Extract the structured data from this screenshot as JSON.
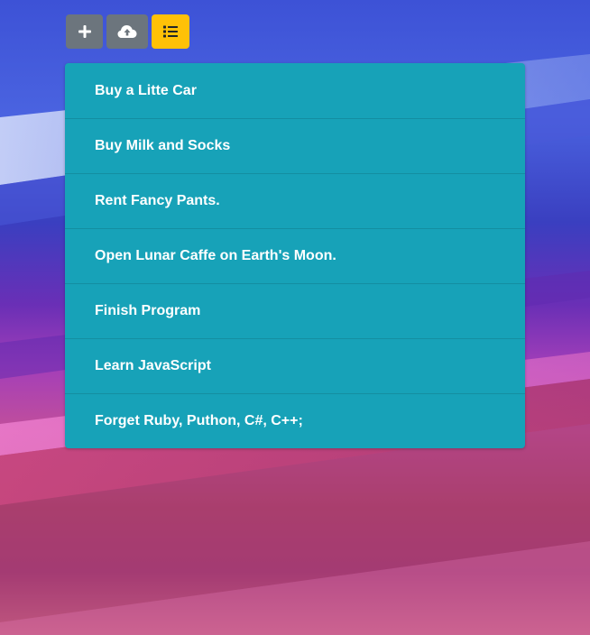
{
  "toolbar": {
    "buttons": [
      {
        "icon": "plus-icon",
        "color": "#6c757d"
      },
      {
        "icon": "cloud-upload-icon",
        "color": "#6c757d"
      },
      {
        "icon": "list-icon",
        "color": "#ffc107"
      }
    ]
  },
  "todo_list": {
    "background": "#17a2b8",
    "items": [
      {
        "label": "Buy a Litte Car"
      },
      {
        "label": "Buy Milk and Socks"
      },
      {
        "label": "Rent Fancy Pants."
      },
      {
        "label": "Open Lunar Caffe on Earth's Moon."
      },
      {
        "label": "Finish Program"
      },
      {
        "label": "Learn JavaScript"
      },
      {
        "label": "Forget Ruby, Puthon, C#, C++;"
      }
    ]
  }
}
